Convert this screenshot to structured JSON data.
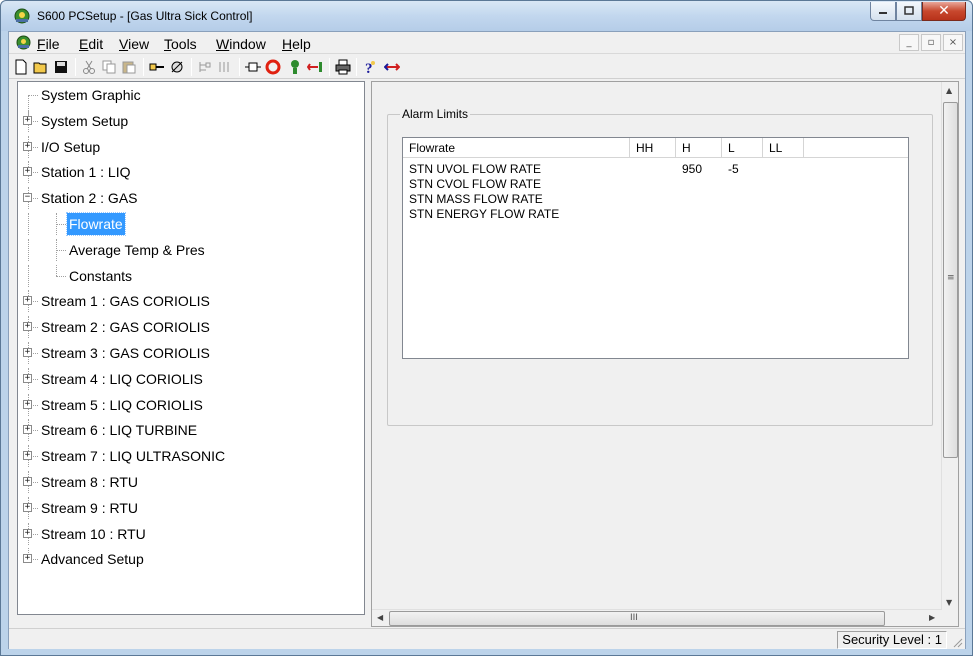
{
  "window": {
    "title": "S600 PCSetup  - [Gas Ultra Sick Control]",
    "buttons": {
      "minimize_icon": "minimize-icon",
      "maximize_icon": "maximize-icon",
      "close_icon": "close-icon"
    }
  },
  "menu": {
    "items": [
      {
        "label": "File",
        "underline": "F"
      },
      {
        "label": "Edit",
        "underline": "E"
      },
      {
        "label": "View",
        "underline": "V"
      },
      {
        "label": "Tools",
        "underline": "T"
      },
      {
        "label": "Window",
        "underline": "W"
      },
      {
        "label": "Help",
        "underline": "H"
      }
    ],
    "mdi_minimize": "_",
    "mdi_restore": "▫",
    "mdi_close": "×"
  },
  "toolbar": {
    "icons": [
      "new-icon",
      "open-icon",
      "save-icon",
      "cut-icon",
      "copy-icon",
      "paste-icon",
      "connect-icon",
      "disconnect-icon",
      "tree-icon",
      "columns-icon",
      "port-icon",
      "stop-icon",
      "upload-icon",
      "download-icon",
      "print-icon",
      "help-icon",
      "transfer-icon"
    ]
  },
  "tree": {
    "items": [
      {
        "label": "System Graphic",
        "level": 0,
        "expander": ""
      },
      {
        "label": "System Setup",
        "level": 0,
        "expander": "+"
      },
      {
        "label": "I/O Setup",
        "level": 0,
        "expander": "+"
      },
      {
        "label": "Station 1 : LIQ",
        "level": 0,
        "expander": "+"
      },
      {
        "label": "Station 2 : GAS",
        "level": 0,
        "expander": "-"
      },
      {
        "label": "Flowrate",
        "level": 1,
        "expander": "",
        "selected": true
      },
      {
        "label": "Average Temp & Pres",
        "level": 1,
        "expander": ""
      },
      {
        "label": "Constants",
        "level": 1,
        "expander": ""
      },
      {
        "label": "Stream 1 : GAS CORIOLIS",
        "level": 0,
        "expander": "+"
      },
      {
        "label": "Stream 2 : GAS CORIOLIS",
        "level": 0,
        "expander": "+"
      },
      {
        "label": "Stream 3 : GAS CORIOLIS",
        "level": 0,
        "expander": "+"
      },
      {
        "label": "Stream 4 : LIQ CORIOLIS",
        "level": 0,
        "expander": "+"
      },
      {
        "label": "Stream 5 : LIQ CORIOLIS",
        "level": 0,
        "expander": "+"
      },
      {
        "label": "Stream 6 : LIQ TURBINE",
        "level": 0,
        "expander": "+"
      },
      {
        "label": "Stream 7 : LIQ ULTRASONIC",
        "level": 0,
        "expander": "+"
      },
      {
        "label": "Stream 8 : RTU",
        "level": 0,
        "expander": "+"
      },
      {
        "label": "Stream 9 : RTU",
        "level": 0,
        "expander": "+"
      },
      {
        "label": "Stream 10 : RTU",
        "level": 0,
        "expander": "+"
      },
      {
        "label": "Advanced Setup",
        "level": 0,
        "expander": "+"
      }
    ]
  },
  "alarm_limits": {
    "group_label": "Alarm Limits",
    "columns": [
      "Flowrate",
      "HH",
      "H",
      "L",
      "LL"
    ],
    "rows": [
      [
        "STN UVOL  FLOW RATE",
        "",
        "950",
        "-5",
        ""
      ],
      [
        "STN CVOL  FLOW RATE",
        "",
        "",
        "",
        ""
      ],
      [
        "STN MASS  FLOW RATE",
        "",
        "",
        "",
        ""
      ],
      [
        "STN ENERGY FLOW RATE",
        "",
        "",
        "",
        ""
      ]
    ]
  },
  "scrollbar": {
    "hgrip": "III",
    "vgrip": "≡"
  },
  "status": {
    "security": "Security Level : 1"
  }
}
